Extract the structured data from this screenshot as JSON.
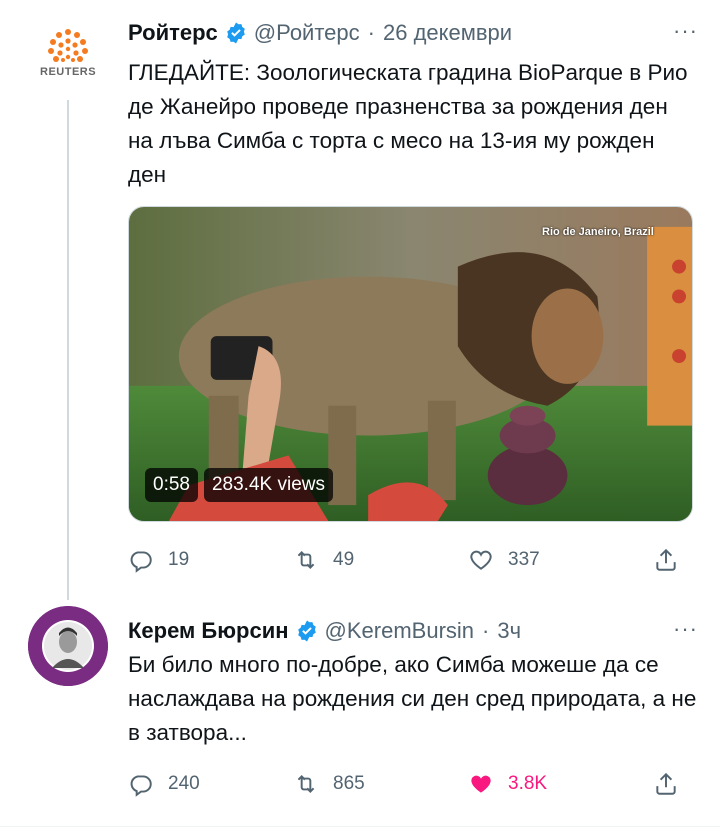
{
  "tweet1": {
    "display_name": "Ройтерс",
    "handle": "@Ройтерс",
    "separator": "·",
    "date": "26 декември",
    "avatar_label": "REUTERS",
    "text": "ГЛЕДАЙТЕ: Зоологическата градина BioParque в Рио де Жанейро проведе празненства за рождения ден на лъва Симба с торта с месо на 13-ия му рожден ден",
    "video": {
      "duration": "0:58",
      "views": "283.4K views",
      "location": "Rio de Janeiro, Brazil"
    },
    "replies": "19",
    "retweets": "49",
    "likes": "337"
  },
  "tweet2": {
    "display_name": "Керем Бюрсин",
    "handle": "@KeremBursin",
    "separator": "·",
    "time": "3ч",
    "text": "Би било много по-добре, ако Симба можеше да се наслаждава на рождения си ден сред природата, а не в затвора...",
    "replies": "240",
    "retweets": "865",
    "likes": "3.8K"
  },
  "more_label": "···",
  "colors": {
    "text": "#0f1419",
    "secondary": "#536471",
    "verified": "#1d9bf0",
    "like_active": "#f91880",
    "avatar_ring": "#7a2b82",
    "reuters_orange": "#f47b20"
  },
  "icons": [
    "reply-icon",
    "retweet-icon",
    "like-icon",
    "share-icon",
    "verified-icon",
    "more-icon"
  ]
}
